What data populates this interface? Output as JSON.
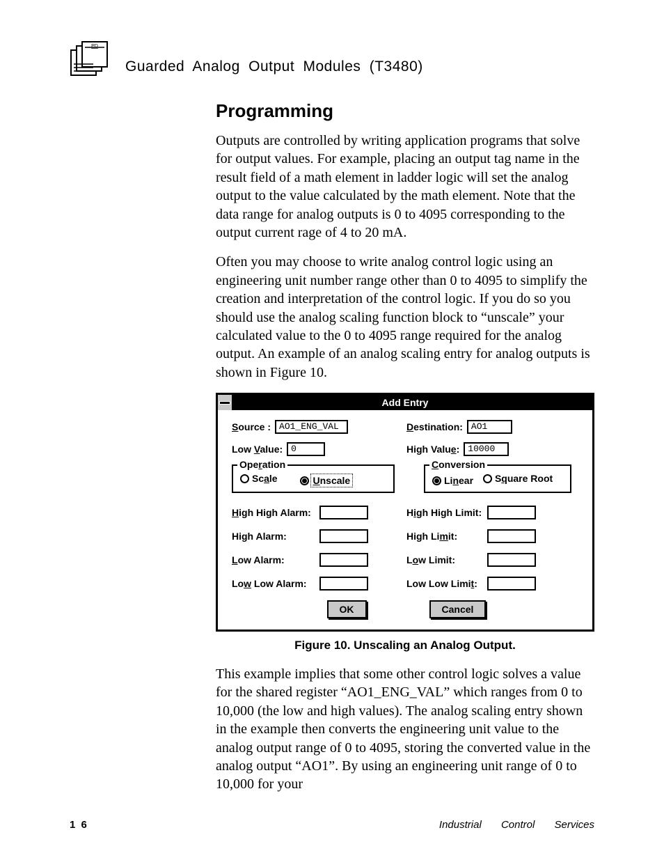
{
  "header": {
    "running_title": "Guarded  Analog  Output  Modules (T3480)"
  },
  "section": {
    "heading": "Programming",
    "para1": "Outputs are controlled by writing application programs that solve for output values.  For example, placing an output tag name in the result field of a math element in ladder logic will set the analog output to the value calculated by the math element.  Note that the data range for analog outputs is 0 to 4095 corresponding to the output current rage of 4 to 20 mA.",
    "para2": "Often you may choose to write analog control logic using an engineering unit number range other than 0 to 4095 to simplify the creation and interpretation of the control logic.  If you do so you should use the analog scaling function block to “unscale” your calculated value to the 0 to 4095 range required for the analog output.  An example of an analog scaling entry for analog outputs is shown in Figure 10.",
    "figure_caption": "Figure 10.  Unscaling an Analog Output.",
    "para3": "This example implies that some other control logic solves a value for the shared register “AO1_ENG_VAL” which ranges from 0 to 10,000 (the low and high values).  The analog scaling entry shown in the example then converts the engineering unit value to the analog output range of 0 to 4095, storing the converted value in the analog output “AO1”. By using an engineering unit range of 0 to 10,000 for your"
  },
  "dialog": {
    "title": "Add Entry",
    "fields": {
      "source_label_pre": "S",
      "source_label_u": "ource",
      "source_label_post": " :",
      "source_value": "AO1_ENG_VAL",
      "dest_label_u": "D",
      "dest_label_post": "estination:",
      "dest_value": "AO1",
      "lowv_pre": "Low ",
      "lowv_u": "V",
      "lowv_post": "alue:",
      "lowv_value": "0",
      "highv_pre": "High Valu",
      "highv_u": "e",
      "highv_post": ":",
      "highv_value": "10000"
    },
    "operation": {
      "legend_pre": "Ope",
      "legend_u": "r",
      "legend_post": "ation",
      "scale_pre": "Sc",
      "scale_u": "a",
      "scale_post": "le",
      "unscale_u": "U",
      "unscale_post": "nscale",
      "selected": "unscale"
    },
    "conversion": {
      "legend_u": "C",
      "legend_post": "onversion",
      "linear_pre": "Li",
      "linear_u": "n",
      "linear_post": "ear",
      "sqrt_pre": "S",
      "sqrt_u": "q",
      "sqrt_post": "uare Root",
      "selected": "linear"
    },
    "alarms": {
      "hh_alarm_u": "H",
      "hh_alarm_post": "igh High Alarm:",
      "h_alarm": "High Alarm:",
      "l_alarm_u": "L",
      "l_alarm_post": "ow Alarm:",
      "ll_alarm_pre": "Lo",
      "ll_alarm_u": "w",
      "ll_alarm_post": " Low Alarm:",
      "hh_limit_pre": "H",
      "hh_limit_u": "i",
      "hh_limit_post": "gh High Limit:",
      "h_limit_pre": "High Li",
      "h_limit_u": "m",
      "h_limit_post": "it:",
      "l_limit_pre": "L",
      "l_limit_u": "o",
      "l_limit_post": "w Limit:",
      "ll_limit_pre": "Low Low Limi",
      "ll_limit_u": "t",
      "ll_limit_post": ":"
    },
    "buttons": {
      "ok": "OK",
      "cancel": "Cancel"
    }
  },
  "footer": {
    "page_number": "1 6",
    "service_line": "Industrial Control Services"
  }
}
